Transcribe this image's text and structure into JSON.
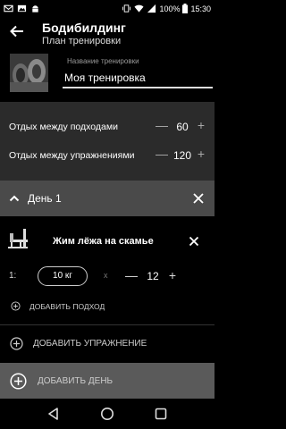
{
  "status_bar": {
    "time": "15:30",
    "battery": "100%"
  },
  "app_bar": {
    "title": "Бодибилдинг",
    "subtitle": "План тренировки"
  },
  "plan": {
    "name_label": "Название тренировки",
    "name_value": "Моя тренировка"
  },
  "rest": [
    {
      "label": "Отдых между подходами",
      "value": "60"
    },
    {
      "label": "Отдых между упражнениями",
      "value": "120"
    }
  ],
  "day": {
    "title": "День 1"
  },
  "exercise": {
    "title": "Жим лёжа на скамье",
    "sets": [
      {
        "number": "1:",
        "weight": "10 кг",
        "separator": "x",
        "reps": "12"
      }
    ],
    "add_set_label": "ДОБАВИТЬ ПОДХОД"
  },
  "add_exercise_label": "ДОБАВИТЬ УПРАЖНЕНИЕ",
  "add_day_label": "ДОБАВИТЬ ДЕНЬ",
  "colors": {
    "background": "#000000",
    "rest_panel": "#2b2b2b",
    "day_header": "#4a4a4a",
    "add_day_bar": "#5a5a5a"
  }
}
